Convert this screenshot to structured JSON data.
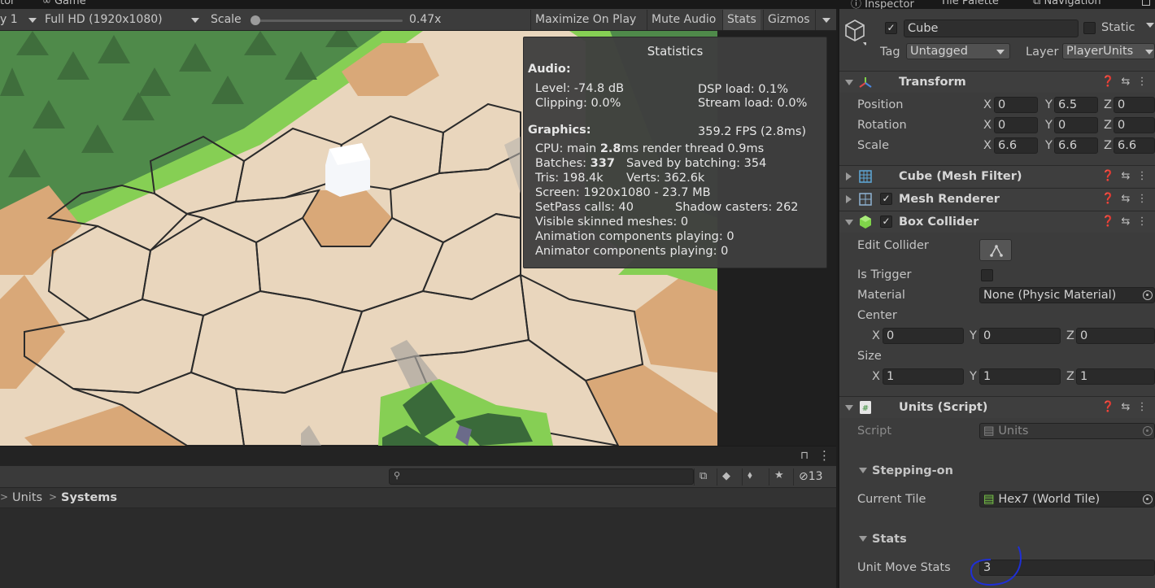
{
  "top_tabs": {
    "console_tab": "tor",
    "game_tab": "Game",
    "inspector_tab": "Inspector",
    "tile_palette_tab": "Tile Palette",
    "navigation_tab": "Navigation"
  },
  "game_toolbar": {
    "display_value": "y 1",
    "resolution_value": "Full HD (1920x1080)",
    "scale_label": "Scale",
    "scale_value": "0.47x",
    "scale_fraction": 0.0,
    "maximize_on_play": "Maximize On Play",
    "mute_audio": "Mute Audio",
    "stats": "Stats",
    "gizmos": "Gizmos"
  },
  "statistics": {
    "title": "Statistics",
    "audio_heading": "Audio:",
    "level": "Level: -74.8 dB",
    "clipping": "Clipping: 0.0%",
    "dsp_load": "DSP load: 0.1%",
    "stream_load": "Stream load: 0.0%",
    "graphics_heading": "Graphics:",
    "fps": "359.2 FPS (2.8ms)",
    "cpu_prefix": "CPU: main ",
    "cpu_main": "2.8",
    "cpu_suffix": "ms  render thread 0.9ms",
    "batches_prefix": "Batches: ",
    "batches_value": "337",
    "saved_by_batching": "Saved by batching: 354",
    "tris": "Tris: 198.4k",
    "verts": "Verts: 362.6k",
    "screen": "Screen: 1920x1080 - 23.7 MB",
    "setpass": "SetPass calls: 40",
    "shadow_casters": "Shadow casters: 262",
    "skinned_meshes": "Visible skinned meshes: 0",
    "animation_components": "Animation components playing: 0",
    "animator_components": "Animator components playing: 0"
  },
  "project_panel": {
    "hidden_count": "13",
    "breadcrumb_parent": "Units",
    "breadcrumb_current": "Systems"
  },
  "inspector": {
    "object_name": "Cube",
    "object_active": true,
    "static_label": "Static",
    "tag_label": "Tag",
    "tag_value": "Untagged",
    "layer_label": "Layer",
    "layer_value": "PlayerUnits",
    "transform": {
      "title": "Transform",
      "position_label": "Position",
      "rotation_label": "Rotation",
      "scale_label": "Scale",
      "position": {
        "x": "0",
        "y": "6.5",
        "z": "0"
      },
      "rotation": {
        "x": "0",
        "y": "0",
        "z": "0"
      },
      "scale": {
        "x": "6.6",
        "y": "6.6",
        "z": "6.6"
      }
    },
    "mesh_filter": {
      "title": "Cube (Mesh Filter)"
    },
    "mesh_renderer": {
      "title": "Mesh Renderer",
      "enabled": true
    },
    "box_collider": {
      "title": "Box Collider",
      "enabled": true,
      "edit_collider_label": "Edit Collider",
      "is_trigger_label": "Is Trigger",
      "is_trigger": false,
      "material_label": "Material",
      "material_value": "None (Physic Material)",
      "center_label": "Center",
      "center": {
        "x": "0",
        "y": "0",
        "z": "0"
      },
      "size_label": "Size",
      "size": {
        "x": "1",
        "y": "1",
        "z": "1"
      }
    },
    "units_script": {
      "title": "Units (Script)",
      "script_label": "Script",
      "script_value": "Units",
      "stepping_on_header": "Stepping-on",
      "current_tile_label": "Current Tile",
      "current_tile_value": "Hex7 (World Tile)",
      "stats_header": "Stats",
      "unit_move_stats_label": "Unit Move Stats",
      "unit_move_stats_value": "3"
    },
    "axis_labels": {
      "x": "X",
      "y": "Y",
      "z": "Z"
    }
  },
  "colors": {
    "editor_bg": "#3c3c3c",
    "grass": "#86cf54",
    "tile_light": "#efdec8",
    "tile_tan": "#d9a878",
    "annotation": "#1f2fd6"
  }
}
